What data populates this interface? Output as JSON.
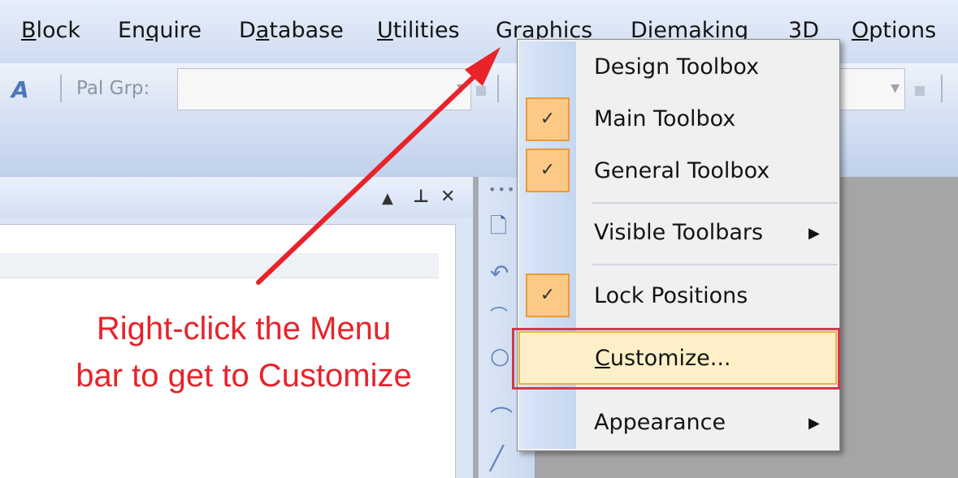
{
  "menubar": {
    "items": [
      {
        "pre": "",
        "ul": "B",
        "post": "lock"
      },
      {
        "pre": "En",
        "ul": "q",
        "post": "uire"
      },
      {
        "pre": "D",
        "ul": "a",
        "post": "tabase"
      },
      {
        "pre": "",
        "ul": "U",
        "post": "tilities"
      },
      {
        "pre": "Gr",
        "ul": "a",
        "post": "phics"
      },
      {
        "pre": "Die",
        "ul": "m",
        "post": "aking"
      },
      {
        "pre": "",
        "ul": "3",
        "post": "D"
      },
      {
        "pre": "",
        "ul": "O",
        "post": "ptions"
      }
    ]
  },
  "toolbar": {
    "pal_grp_label": "Pal Grp:",
    "icon": "font-style-icon"
  },
  "pane": {
    "controls": {
      "up": "▲",
      "pin": "⊥",
      "close": "✕"
    }
  },
  "context_menu": {
    "items": [
      {
        "label": "Design Toolbox",
        "checked": false
      },
      {
        "label": "Main Toolbox",
        "checked": true
      },
      {
        "label": "General Toolbox",
        "checked": true
      },
      {
        "label": "Visible Toolbars",
        "submenu": true
      },
      {
        "label": "Lock Positions",
        "checked": true
      },
      {
        "label_ul": "C",
        "label_rest": "ustomize...",
        "highlighted": true
      },
      {
        "label": "Appearance",
        "submenu": true
      }
    ],
    "check_glyph": "✓",
    "submenu_glyph": "▶"
  },
  "annotation": {
    "line1": "Right-click the Menu",
    "line2": "bar to get to Customize",
    "color": "#e8232a"
  },
  "colors": {
    "menubar_bg": "#dce6f6",
    "check_bg": "#fdc986",
    "highlight_bg": "#fdf0c8",
    "callout_red": "#d03a4a"
  }
}
